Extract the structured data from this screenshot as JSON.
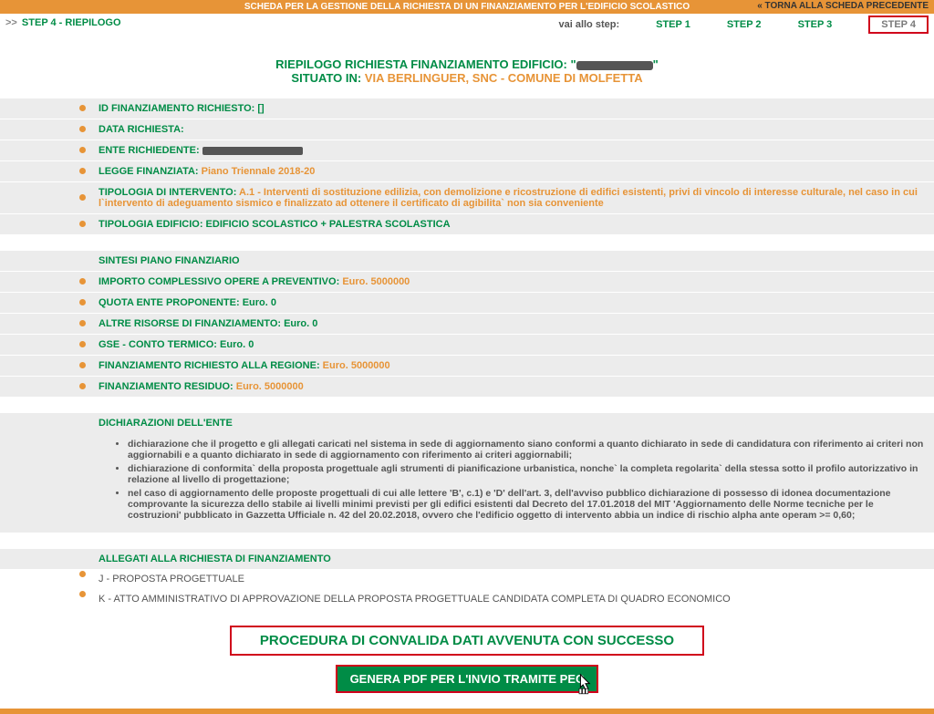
{
  "topbar": "SCHEDA PER LA GESTIONE DELLA RICHIESTA DI UN FINANZIAMENTO PER L'EDIFICIO SCOLASTICO",
  "step_left_arrow": ">>",
  "step_left_label": "STEP 4 - RIEPILOGO",
  "back_link": "« TORNA ALLA SCHEDA PRECEDENTE",
  "nav": {
    "lbl": "vai allo step:",
    "s1": "STEP 1",
    "s2": "STEP 2",
    "s3": "STEP 3",
    "s4": "STEP 4"
  },
  "title": {
    "line1_a": "RIEPILOGO RICHIESTA FINANZIAMENTO EDIFICIO: \"",
    "line1_b": "\"",
    "line2_lbl": "SITUATO IN: ",
    "line2_val": "VIA BERLINGUER, SNC - COMUNE DI MOLFETTA"
  },
  "rows": {
    "id_lbl": "ID FINANZIAMENTO RICHIESTO: [",
    "id_suf": "]",
    "data_lbl": "DATA RICHIESTA:",
    "ente_lbl": "ENTE RICHIEDENTE: ",
    "legge_lbl": "LEGGE FINANZIATA: ",
    "legge_val": "Piano Triennale 2018-20",
    "tipoint_lbl": "TIPOLOGIA DI INTERVENTO: ",
    "tipoint_val": "A.1 - Interventi di sostituzione edilizia, con demolizione e ricostruzione di edifici esistenti, privi di vincolo di interesse culturale, nel caso in cui l`intervento di adeguamento sismico e finalizzato ad ottenere il certificato di agibilita` non sia conveniente",
    "tipoed_lbl": "TIPOLOGIA EDIFICIO: ",
    "tipoed_val": "EDIFICIO SCOLASTICO + PALESTRA SCOLASTICA"
  },
  "fin_hdr": "SINTESI PIANO FINANZIARIO",
  "fin": {
    "imp_lbl": "IMPORTO COMPLESSIVO OPERE A PREVENTIVO: ",
    "imp_val": "Euro. 5000000",
    "quota_lbl": "QUOTA ENTE PROPONENTE: ",
    "quota_val": "Euro. 0",
    "altre_lbl": "ALTRE RISORSE DI FINANZIAMENTO: ",
    "altre_val": "Euro. 0",
    "gse_lbl": "GSE - CONTO TERMICO: ",
    "gse_val": "Euro. 0",
    "regione_lbl": "FINANZIAMENTO RICHIESTO ALLA REGIONE: ",
    "regione_val": "Euro. 5000000",
    "residuo_lbl": "FINANZIAMENTO RESIDUO: ",
    "residuo_val": "Euro. 5000000"
  },
  "decl_hdr": "DICHIARAZIONI DELL'ENTE",
  "decl": {
    "d1": "dichiarazione che il progetto e gli allegati caricati nel sistema in sede di aggiornamento siano conformi a quanto dichiarato in sede di candidatura con riferimento ai criteri non aggiornabili e a quanto dichiarato in sede di aggiornamento con riferimento ai criteri aggiornabili;",
    "d2": "dichiarazione di conformita` della proposta progettuale agli strumenti di pianificazione urbanistica, nonche` la completa regolarita` della stessa sotto il profilo autorizzativo in relazione al livello di progettazione;",
    "d3": "nel caso di aggiornamento delle proposte progettuali di cui alle lettere 'B', c.1) e 'D' dell'art. 3, dell'avviso pubblico dichiarazione di possesso di idonea documentazione comprovante la sicurezza dello stabile ai livelli minimi previsti per gli edifici esistenti dal Decreto del 17.01.2018 del MIT 'Aggiornamento delle Norme tecniche per le costruzioni' pubblicato in Gazzetta Ufficiale n. 42 del 20.02.2018, ovvero che l'edificio oggetto di intervento abbia un indice di rischio alpha ante operam >= 0,60;"
  },
  "all_hdr": "ALLEGATI ALLA RICHIESTA DI FINANZIAMENTO",
  "all": {
    "j": "J - PROPOSTA PROGETTUALE",
    "k": "K - ATTO AMMINISTRATIVO DI APPROVAZIONE DELLA PROPOSTA PROGETTUALE CANDIDATA COMPLETA DI QUADRO ECONOMICO"
  },
  "success": "PROCEDURA DI CONVALIDA DATI AVVENUTA CON SUCCESSO",
  "pecbtn": "GENERA PDF PER L'INVIO TRAMITE PEC"
}
